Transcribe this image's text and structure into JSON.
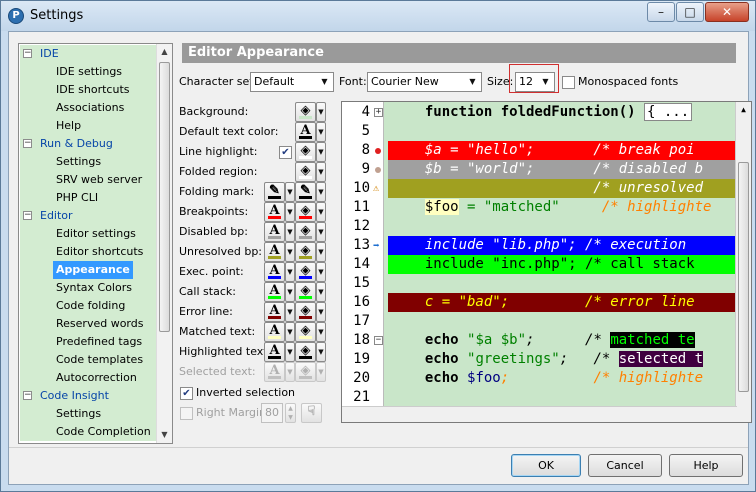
{
  "window": {
    "title": "Settings",
    "minimize": "–",
    "maximize": "□",
    "close": "✕",
    "app_icon": "P"
  },
  "tree": {
    "items": [
      {
        "type": "cat",
        "label": "IDE",
        "exp": "−"
      },
      {
        "type": "child",
        "label": "IDE settings"
      },
      {
        "type": "child",
        "label": "IDE shortcuts"
      },
      {
        "type": "child",
        "label": "Associations"
      },
      {
        "type": "child",
        "label": "Help"
      },
      {
        "type": "cat",
        "label": "Run & Debug",
        "exp": "−"
      },
      {
        "type": "child",
        "label": "Settings"
      },
      {
        "type": "child",
        "label": "SRV web server"
      },
      {
        "type": "child",
        "label": "PHP CLI"
      },
      {
        "type": "cat",
        "label": "Editor",
        "exp": "−"
      },
      {
        "type": "child",
        "label": "Editor settings"
      },
      {
        "type": "child",
        "label": "Editor shortcuts"
      },
      {
        "type": "child",
        "label": "Appearance",
        "selected": true
      },
      {
        "type": "child",
        "label": "Syntax Colors"
      },
      {
        "type": "child",
        "label": "Code folding"
      },
      {
        "type": "child",
        "label": "Reserved words"
      },
      {
        "type": "child",
        "label": "Predefined tags"
      },
      {
        "type": "child",
        "label": "Code templates"
      },
      {
        "type": "child",
        "label": "Autocorrection"
      },
      {
        "type": "cat",
        "label": "Code Insight",
        "exp": "−"
      },
      {
        "type": "child",
        "label": "Settings"
      },
      {
        "type": "child",
        "label": "Code Completion"
      }
    ]
  },
  "panel": {
    "title": "Editor Appearance"
  },
  "charset": {
    "label": "Character set:",
    "value": "Default"
  },
  "font": {
    "label": "Font:",
    "value": "Courier New"
  },
  "size": {
    "label": "Size:",
    "value": "12"
  },
  "monospaced": {
    "label": "Monospaced fonts",
    "checked": false
  },
  "attributes": [
    {
      "label": "Background:",
      "buttons": [
        "fill"
      ],
      "color": "#c9e6c9"
    },
    {
      "label": "Default text color:",
      "buttons": [
        "text"
      ],
      "color": "#000000"
    },
    {
      "label": "Line highlight:",
      "checkbox": true,
      "buttons": [
        "fill"
      ],
      "color": "#ffffff"
    },
    {
      "label": "Folded region:",
      "buttons": [
        "fill"
      ],
      "color": "#ffffff"
    },
    {
      "label": "Folding mark:",
      "buttons": [
        "pen",
        "pen"
      ],
      "color": "#000000"
    },
    {
      "label": "Breakpoints:",
      "buttons": [
        "text",
        "fill"
      ],
      "color": "#ff0000"
    },
    {
      "label": "Disabled bp:",
      "buttons": [
        "text",
        "fill"
      ],
      "color": "#a0a0a0"
    },
    {
      "label": "Unresolved bp:",
      "buttons": [
        "text",
        "fill"
      ],
      "color": "#a0a020"
    },
    {
      "label": "Exec. point:",
      "buttons": [
        "text",
        "fill"
      ],
      "color": "#0000ff"
    },
    {
      "label": "Call stack:",
      "buttons": [
        "text",
        "fill"
      ],
      "color": "#00ff00"
    },
    {
      "label": "Error line:",
      "buttons": [
        "text",
        "fill"
      ],
      "color": "#800000"
    },
    {
      "label": "Matched text:",
      "buttons": [
        "text",
        "fill"
      ],
      "color": "#ffffc0"
    },
    {
      "label": "Highlighted text:",
      "buttons": [
        "text",
        "fill"
      ],
      "color": "#000000"
    },
    {
      "label": "Selected text:",
      "buttons": [
        "text",
        "fill"
      ],
      "color": "#c0c0c0",
      "disabled": true
    }
  ],
  "inverted_selection": {
    "label": "Inverted selection",
    "checked": true
  },
  "right_margin": {
    "label": "Right Margin:",
    "value": "80",
    "checked": false
  },
  "preview": {
    "lines": [
      {
        "n": "4",
        "fold": "+",
        "segs": [
          {
            "t": "  function foldedFunction() ",
            "c": "#000",
            "b": true
          },
          {
            "t": "{ ...",
            "c": "#000",
            "box": true
          }
        ],
        "bg": ""
      },
      {
        "n": "5",
        "segs": [],
        "bg": ""
      },
      {
        "n": "8",
        "mark": "bp",
        "segs": [
          {
            "t": "  $a = \"hello\";       /* break poi",
            "c": "#ffffff"
          }
        ],
        "bg": "#ff0000"
      },
      {
        "n": "9",
        "mark": "dbp",
        "segs": [
          {
            "t": "  $b = \"world\";       /* disabled b",
            "c": "#ffffff"
          }
        ],
        "bg": "#a0a0a0"
      },
      {
        "n": "10",
        "mark": "ubp",
        "segs": [
          {
            "t": "                      /* unresolved",
            "c": "#ffffff"
          }
        ],
        "bg": "#a0a020"
      },
      {
        "n": "11",
        "segs": [
          {
            "t": "  ",
            "c": "#000"
          },
          {
            "t": "$foo",
            "c": "#000",
            "hl": "#ffffc0"
          },
          {
            "t": " = \"matched\"     ",
            "c": "#008000"
          },
          {
            "t": "/* highlighte",
            "c": "#ff8000"
          }
        ],
        "bg": ""
      },
      {
        "n": "12",
        "segs": [],
        "bg": ""
      },
      {
        "n": "13",
        "mark": "exec",
        "segs": [
          {
            "t": "  include \"lib.php\"; /* execution",
            "c": "#ffffff"
          }
        ],
        "bg": "#0000ff"
      },
      {
        "n": "14",
        "segs": [
          {
            "t": "  include \"inc.php\"; /* call stack",
            "c": "#000000"
          }
        ],
        "bg": "#00ff00"
      },
      {
        "n": "15",
        "segs": [],
        "bg": ""
      },
      {
        "n": "16",
        "segs": [
          {
            "t": "  c = \"bad\";         /* error line",
            "c": "#ffff00"
          }
        ],
        "bg": "#800000"
      },
      {
        "n": "17",
        "segs": [],
        "bg": ""
      },
      {
        "n": "18",
        "fold": "−",
        "segs": [
          {
            "t": "  echo ",
            "c": "#000",
            "b": true
          },
          {
            "t": "\"$a $b\"",
            "c": "#008000"
          },
          {
            "t": ";      /* ",
            "c": "#000"
          },
          {
            "t": "matched te",
            "c": "#00ff00",
            "hl": "#000000"
          }
        ],
        "bg": ""
      },
      {
        "n": "19",
        "segs": [
          {
            "t": "  echo ",
            "c": "#000",
            "b": true
          },
          {
            "t": "\"greetings\"",
            "c": "#008000"
          },
          {
            "t": ";   /* ",
            "c": "#000"
          },
          {
            "t": "selected t",
            "c": "#ffffff",
            "hl": "#400040"
          }
        ],
        "bg": ""
      },
      {
        "n": "20",
        "segs": [
          {
            "t": "  echo ",
            "c": "#000",
            "b": true
          },
          {
            "t": "$foo",
            "c": "#000080"
          },
          {
            "t": ";          /* highlighte",
            "c": "#ff8000"
          }
        ],
        "bg": ""
      },
      {
        "n": "21",
        "segs": [],
        "bg": ""
      },
      {
        "n": "",
        "segs": [
          {
            "t": "?>",
            "c": "#ff0000"
          }
        ],
        "bg": ""
      }
    ]
  },
  "buttons": {
    "ok": "OK",
    "cancel": "Cancel",
    "help": "Help"
  }
}
